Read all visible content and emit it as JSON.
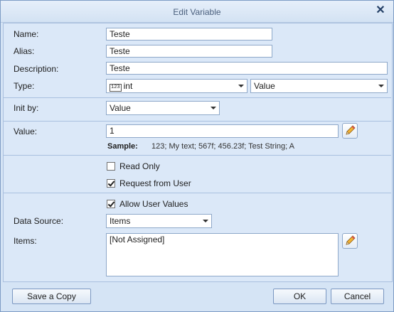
{
  "dialog": {
    "title": "Edit Variable",
    "close_glyph": "✕"
  },
  "fields": {
    "name": {
      "label": "Name:",
      "value": "Teste"
    },
    "alias": {
      "label": "Alias:",
      "value": "Teste"
    },
    "description": {
      "label": "Description:",
      "value": "Teste"
    },
    "type": {
      "label": "Type:",
      "type_badge": "123",
      "type_value": "int",
      "kind_value": "Value"
    },
    "init_by": {
      "label": "Init by:",
      "value": "Value"
    },
    "value": {
      "label": "Value:",
      "value": "1"
    },
    "sample": {
      "label": "Sample:",
      "text": "123; My text; 567f; 456.23f; Test String; A"
    }
  },
  "options": {
    "read_only": {
      "label": "Read Only",
      "checked": false
    },
    "request_from_user": {
      "label": "Request from User",
      "checked": true
    },
    "allow_user_values": {
      "label": "Allow User Values",
      "checked": true
    }
  },
  "data_source": {
    "label": "Data Source:",
    "value": "Items"
  },
  "items": {
    "label": "Items:",
    "value": "[Not Assigned]"
  },
  "buttons": {
    "save_copy": "Save a Copy",
    "ok": "OK",
    "cancel": "Cancel"
  },
  "icons": {
    "edit": "pencil-icon",
    "close": "close-icon",
    "dropdown": "chevron-down-icon"
  }
}
